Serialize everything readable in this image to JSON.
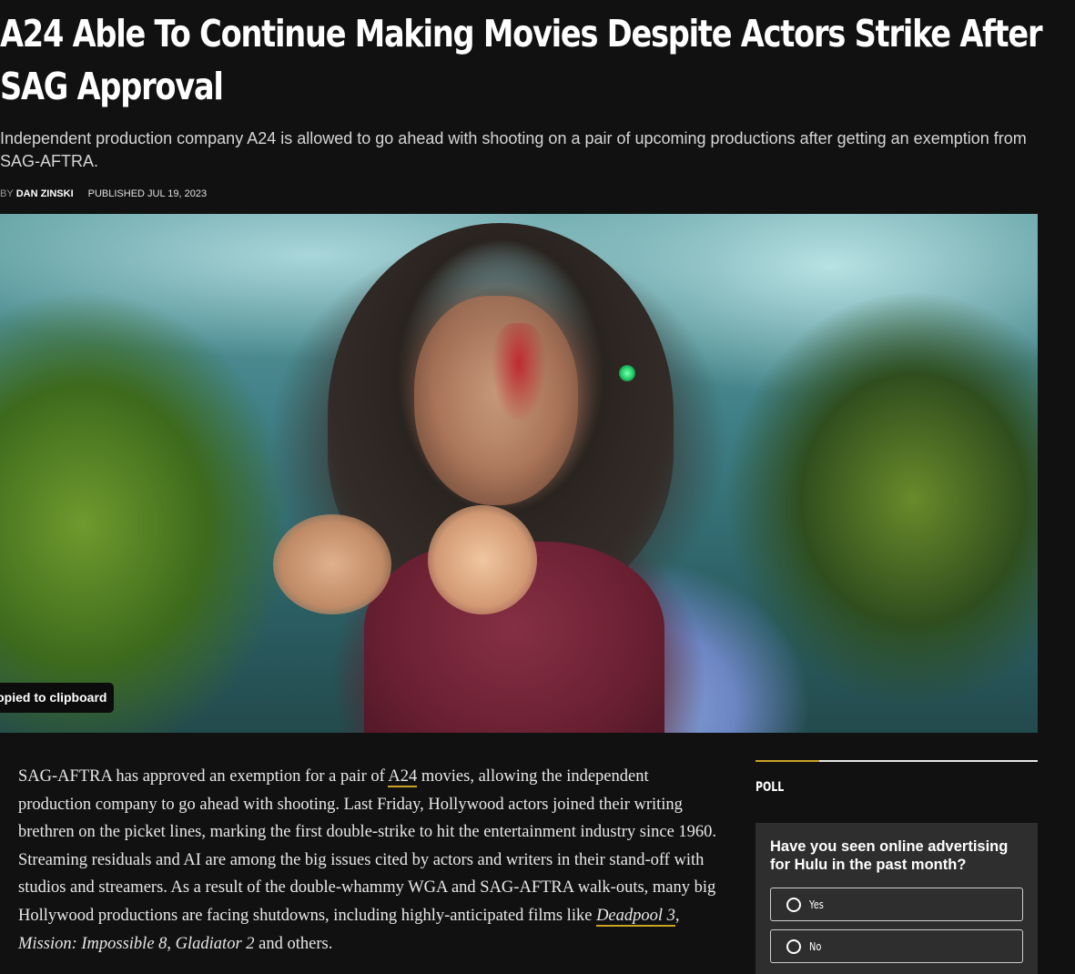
{
  "article": {
    "title": "A24 Able To Continue Making Movies Despite Actors Strike After SAG Approval",
    "subtitle": "Independent production company A24 is allowed to go ahead with shooting on a pair of upcoming productions after getting an exemption from SAG-AFTRA.",
    "byline": {
      "prefix": "BY",
      "author": "DAN ZINSKI",
      "published": "PUBLISHED JUL 19, 2023"
    },
    "toast": "Copied to clipboard",
    "body": {
      "p1": "SAG-AFTRA has approved an exemption for a pair of ",
      "link_a24": "A24",
      "p2": " movies, allowing the independent production company to go ahead with shooting. Last Friday, Hollywood actors joined their writing brethren on the picket lines, marking the first double-strike to hit the entertainment industry since 1960. Streaming residuals and AI are among the big issues cited by actors and writers in their stand-off with studios and streamers. As a result of the double-whammy WGA and SAG-AFTRA walk-outs, many big Hollywood productions are facing shutdowns, including highly-anticipated films like ",
      "link_deadpool": "Deadpool 3",
      "p3": ", ",
      "film_mi": "Mission: Impossible 8",
      "p4": ", ",
      "film_gladiator": "Gladiator 2",
      "p5": " and others."
    }
  },
  "sidebar": {
    "poll": {
      "heading": "POLL",
      "question": "Have you seen online advertising for Hulu in the past month?",
      "options": [
        "Yes",
        "No"
      ]
    }
  },
  "colors": {
    "background": "#111111",
    "accent_gold": "#c9a227",
    "poll_box": "#2e2e2e"
  }
}
